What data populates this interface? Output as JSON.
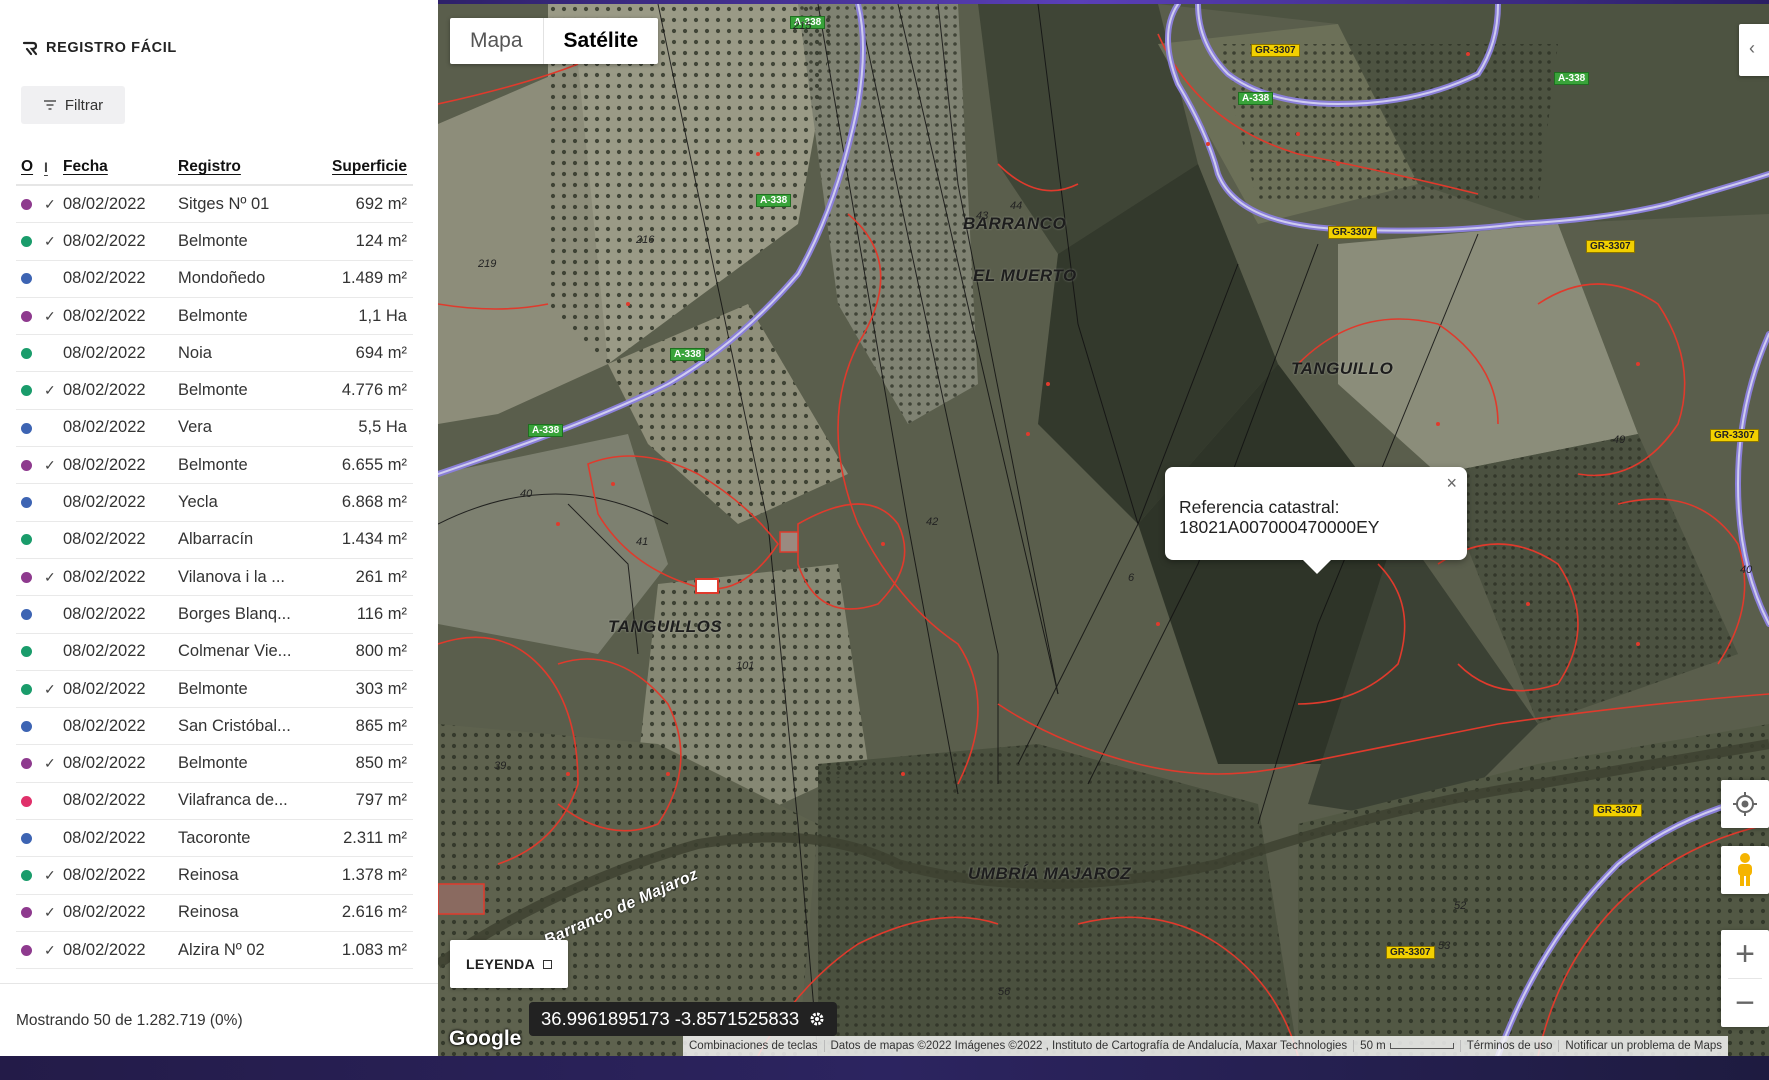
{
  "app": {
    "brand": "REGISTRO FÁCIL"
  },
  "toolbar": {
    "filter_label": "Filtrar"
  },
  "table": {
    "headers": {
      "o": "O",
      "i": "I",
      "date": "Fecha",
      "registry": "Registro",
      "surface": "Superficie"
    },
    "rows": [
      {
        "color": "#8e3a8e",
        "checked": true,
        "date": "08/02/2022",
        "registry": "Sitges Nº 01",
        "surface": "692 m²"
      },
      {
        "color": "#1a9c6b",
        "checked": true,
        "date": "08/02/2022",
        "registry": "Belmonte",
        "surface": "124 m²"
      },
      {
        "color": "#3d64b3",
        "checked": false,
        "date": "08/02/2022",
        "registry": "Mondoñedo",
        "surface": "1.489 m²"
      },
      {
        "color": "#8e3a8e",
        "checked": true,
        "date": "08/02/2022",
        "registry": "Belmonte",
        "surface": "1,1 Ha"
      },
      {
        "color": "#1a9c6b",
        "checked": false,
        "date": "08/02/2022",
        "registry": "Noia",
        "surface": "694 m²"
      },
      {
        "color": "#1a9c6b",
        "checked": true,
        "date": "08/02/2022",
        "registry": "Belmonte",
        "surface": "4.776 m²"
      },
      {
        "color": "#3d64b3",
        "checked": false,
        "date": "08/02/2022",
        "registry": "Vera",
        "surface": "5,5 Ha"
      },
      {
        "color": "#8e3a8e",
        "checked": true,
        "date": "08/02/2022",
        "registry": "Belmonte",
        "surface": "6.655 m²"
      },
      {
        "color": "#3d64b3",
        "checked": false,
        "date": "08/02/2022",
        "registry": "Yecla",
        "surface": "6.868 m²"
      },
      {
        "color": "#1a9c6b",
        "checked": false,
        "date": "08/02/2022",
        "registry": "Albarracín",
        "surface": "1.434 m²"
      },
      {
        "color": "#8e3a8e",
        "checked": true,
        "date": "08/02/2022",
        "registry": "Vilanova i la ...",
        "surface": "261 m²"
      },
      {
        "color": "#3d64b3",
        "checked": false,
        "date": "08/02/2022",
        "registry": "Borges Blanq...",
        "surface": "116 m²"
      },
      {
        "color": "#1a9c6b",
        "checked": false,
        "date": "08/02/2022",
        "registry": "Colmenar Vie...",
        "surface": "800 m²"
      },
      {
        "color": "#1a9c6b",
        "checked": true,
        "date": "08/02/2022",
        "registry": "Belmonte",
        "surface": "303 m²"
      },
      {
        "color": "#3d64b3",
        "checked": false,
        "date": "08/02/2022",
        "registry": "San Cristóbal...",
        "surface": "865 m²"
      },
      {
        "color": "#8e3a8e",
        "checked": true,
        "date": "08/02/2022",
        "registry": "Belmonte",
        "surface": "850 m²"
      },
      {
        "color": "#e0306a",
        "checked": false,
        "date": "08/02/2022",
        "registry": "Vilafranca de...",
        "surface": "797 m²"
      },
      {
        "color": "#3d64b3",
        "checked": false,
        "date": "08/02/2022",
        "registry": "Tacoronte",
        "surface": "2.311 m²"
      },
      {
        "color": "#1a9c6b",
        "checked": true,
        "date": "08/02/2022",
        "registry": "Reinosa",
        "surface": "1.378 m²"
      },
      {
        "color": "#8e3a8e",
        "checked": true,
        "date": "08/02/2022",
        "registry": "Reinosa",
        "surface": "2.616 m²"
      },
      {
        "color": "#8e3a8e",
        "checked": true,
        "date": "08/02/2022",
        "registry": "Alzira Nº 02",
        "surface": "1.083 m²"
      }
    ],
    "check_glyph": "✓"
  },
  "footer": {
    "showing": "Mostrando 50 de 1.282.719 (0%)"
  },
  "map": {
    "type_options": [
      "Mapa",
      "Satélite"
    ],
    "selected_type": "Satélite",
    "popup": {
      "line1": "Referencia catastral:",
      "line2": "18021A007000470000EY",
      "close": "×"
    },
    "legend_label": "LEYENDA",
    "coordinates": "36.9961895173 -3.8571525833",
    "google": "Google",
    "attribution": {
      "shortcuts": "Combinaciones de teclas",
      "data": "Datos de mapas ©2022 Imágenes ©2022 , Instituto de Cartografía de Andalucía, Maxar Technologies",
      "scale": "50 m",
      "terms": "Términos de uso",
      "report": "Notificar un problema de Maps"
    },
    "zoom_in": "+",
    "zoom_out": "−",
    "place_labels": [
      "BARRANCO",
      "EL MUERTO",
      "TANGUILLO",
      "TANGUILLOS",
      "UMBRÍA MAJAROZ",
      "Barranco de Majaroz"
    ],
    "road_tags": [
      "A-338",
      "GR-3307"
    ],
    "parcel_numbers": [
      "215",
      "216",
      "219",
      "40",
      "41",
      "42",
      "43",
      "44",
      "49",
      "101",
      "39",
      "56",
      "52",
      "53",
      "40",
      "6"
    ],
    "colors": {
      "road": "#7b6ad8",
      "parcel": "#e03a2c",
      "terrain": "#4e5244"
    }
  }
}
